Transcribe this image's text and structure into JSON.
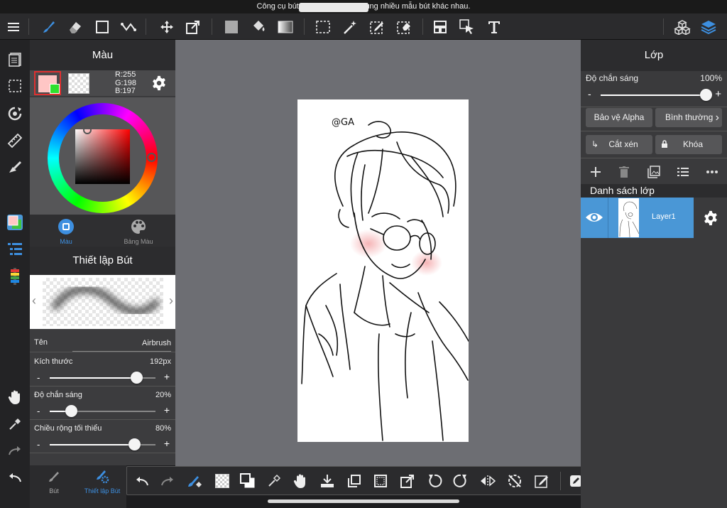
{
  "notice": {
    "text": "Công cụ bút vẽ cho phép bạn dùng nhiều mẫu bút khác nhau."
  },
  "color_panel": {
    "title": "Màu",
    "rgb": {
      "r": "R:255",
      "g": "G:198",
      "b": "B:197"
    },
    "main_color": "#ffc6c5",
    "tabs": [
      {
        "label": "Màu"
      },
      {
        "label": "Bảng Màu"
      }
    ]
  },
  "brush_panel": {
    "title": "Thiết lập Bút",
    "name_label": "Tên",
    "name_value": "Airbrush",
    "params": [
      {
        "label": "Kích thước",
        "value": "192px",
        "level": 0.82
      },
      {
        "label": "Độ chắn sáng",
        "value": "20%",
        "level": 0.2
      },
      {
        "label": "Chiều rộng tối thiểu",
        "value": "80%",
        "level": 0.8
      }
    ],
    "minus": "-",
    "plus": "+"
  },
  "bottom_tabs": [
    {
      "label": "Bút"
    },
    {
      "label": "Thiết lập Bút"
    }
  ],
  "canvas": {
    "signature": "@GA"
  },
  "layer_panel": {
    "title": "Lớp",
    "opacity_label": "Độ chắn sáng",
    "opacity_value": "100%",
    "opacity_level": 1.0,
    "alpha_protect": "Bảo vệ Alpha",
    "blend_mode": "Bình thường",
    "clipping": "Cắt xén",
    "lock": "Khóa",
    "list_title": "Danh sách lớp",
    "layers": [
      {
        "name": "Layer1"
      }
    ]
  },
  "colors": {
    "accent": "#4a97d6",
    "toolbar": "#2b2b2d",
    "canvas_bg": "#6d6e73"
  }
}
